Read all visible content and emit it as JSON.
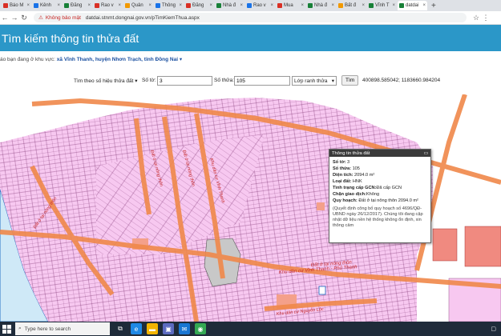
{
  "browser": {
    "tabs": [
      {
        "label": "Báo M",
        "color": "#d93025"
      },
      {
        "label": "Kênh",
        "color": "#1a73e8"
      },
      {
        "label": "Đăng",
        "color": "#188038"
      },
      {
        "label": "Rao v",
        "color": "#d93025"
      },
      {
        "label": "Quản",
        "color": "#f29900"
      },
      {
        "label": "Thông",
        "color": "#1a73e8"
      },
      {
        "label": "Đăng",
        "color": "#d93025"
      },
      {
        "label": "Nhà đ",
        "color": "#188038"
      },
      {
        "label": "Rao v",
        "color": "#1a73e8"
      },
      {
        "label": "Mua",
        "color": "#d93025"
      },
      {
        "label": "Nhà đ",
        "color": "#188038"
      },
      {
        "label": "Bất đ",
        "color": "#f29900"
      },
      {
        "label": "Vĩnh T",
        "color": "#188038"
      },
      {
        "label": "datdai",
        "color": "#188038",
        "active": true
      }
    ],
    "new_tab": "+",
    "security_label": "Không bảo mật",
    "url": "datdai.stnmt.dongnai.gov.vn/pTimKiemThua.aspx"
  },
  "page": {
    "title": "Tìm kiếm thông tin thửa đất",
    "area_prefix": "áo bạn đang ở khu vực:",
    "area_location": "xã Vĩnh Thanh, huyện Nhơn Trạch, tỉnh Đồng Nai",
    "area_caret": "▾"
  },
  "search": {
    "mode_label": "Tìm theo số hiệu thửa đất",
    "mode_caret": "▾",
    "sheet_label": "Số tờ:",
    "sheet_value": "3",
    "parcel_label": "Số thửa:",
    "parcel_value": "105",
    "layer_select": "Lớp ranh thửa",
    "button": "Tìm",
    "coordinates": "400898.585042; 1183660.984204"
  },
  "popup": {
    "title": "Thông tin thửa đất",
    "rows": [
      {
        "label": "Số tờ:",
        "value": " 3"
      },
      {
        "label": "Số thửa:",
        "value": " 105"
      },
      {
        "label": "Diện tích:",
        "value": " 2094.0 m²"
      },
      {
        "label": "Loại đất:",
        "value": " HNK"
      },
      {
        "label": "Tình trạng cấp GCN:",
        "value": "Đã cấp GCN"
      },
      {
        "label": "Chặn giao dịch:",
        "value": "Không"
      },
      {
        "label": "Quy hoạch:",
        "value": " Đất ở tại nông thôn 2094.0 m²"
      }
    ],
    "note": "(Quyết định công bố quy hoạch số 4696/QĐ-UBND ngày 26/12/2017). Chúng tôi đang cập nhật dữ liệu nền hệ thống không ổn định, xin thông cảm"
  },
  "map_labels": {
    "road_1": "Đất ở tại nông thôn",
    "road_2": "Khu dân cư Vĩnh Thanh - Phú Thạnh",
    "road_3": "Đất ở tại nông thôn",
    "road_4": "Đất ở tại nông thôn",
    "road_5": "Khu dân cư Vĩnh Thanh",
    "road_6": "Đất ở tại nông thôn",
    "road_7": "Khu dân cư Nguyễn Lộc"
  },
  "taskbar": {
    "search_placeholder": "Type here to search",
    "colors": {
      "edge": "#1e88e5",
      "explorer": "#f4b400",
      "store": "#5c6bc0",
      "mail": "#1976d2",
      "chrome": "#34a853"
    }
  }
}
